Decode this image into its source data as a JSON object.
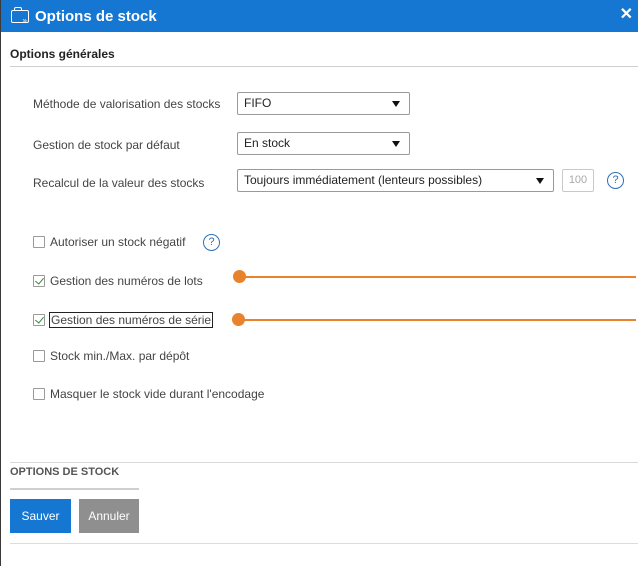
{
  "window": {
    "title": "Options de stock",
    "close_symbol": "✕"
  },
  "section": {
    "title": "Options générales"
  },
  "fields": {
    "valuation": {
      "label": "Méthode de valorisation des stocks",
      "value": "FIFO"
    },
    "default_stock": {
      "label": "Gestion de stock par défaut",
      "value": "En stock"
    },
    "recalc": {
      "label": "Recalcul de la valeur des stocks",
      "value": "Toujours immédiatement (lenteurs possibles)",
      "number_value": "100",
      "help": "?"
    }
  },
  "checkboxes": {
    "negative_stock": {
      "label": "Autoriser un stock négatif",
      "checked": false,
      "help": "?"
    },
    "lot_numbers": {
      "label": "Gestion des numéros de lots",
      "checked": true
    },
    "serial_numbers": {
      "label": "Gestion des numéros de série",
      "checked": true
    },
    "min_max": {
      "label": "Stock min./Max. par dépôt",
      "checked": false
    },
    "hide_empty": {
      "label": "Masquer le stock vide durant l'encodage",
      "checked": false
    }
  },
  "footer": {
    "title": "OPTIONS DE STOCK",
    "save_label": "Sauver",
    "cancel_label": "Annuler"
  },
  "colors": {
    "accent": "#1677d2",
    "callout": "#e8822c",
    "cancel": "#8f8f8f"
  },
  "icons": {
    "title": "folder-icon",
    "close": "close-icon",
    "help": "help-icon",
    "caret": "caret-down-icon"
  }
}
